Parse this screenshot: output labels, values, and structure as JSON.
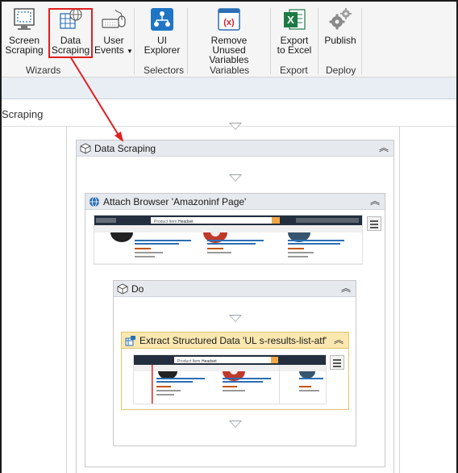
{
  "ribbon": {
    "buttons": [
      {
        "key": "screen_scraping",
        "label": "Screen\nScraping"
      },
      {
        "key": "data_scraping",
        "label": "Data\nScraping"
      },
      {
        "key": "user_events",
        "label": "User\nEvents",
        "dropdown": true
      },
      {
        "key": "ui_explorer",
        "label": "UI\nExplorer"
      },
      {
        "key": "remove_unused_variables",
        "label": "Remove Unused\nVariables"
      },
      {
        "key": "export_to_excel",
        "label": "Export\nto Excel"
      },
      {
        "key": "publish",
        "label": "Publish"
      }
    ],
    "groups": [
      "Wizards",
      "Selectors",
      "Variables",
      "Export",
      "Deploy"
    ]
  },
  "tab": {
    "title": "Scraping"
  },
  "workflow": {
    "data_scraping": {
      "title": "Data Scraping"
    },
    "attach_browser": {
      "title": "Attach Browser 'Amazoninf Page'",
      "search_text": "Product Item",
      "search_value": "Headset"
    },
    "do": {
      "title": "Do"
    },
    "extract": {
      "title": "Extract Structured Data 'UL  s-results-list-atf'",
      "search_text": "Product Item",
      "search_value": "Headset"
    }
  },
  "colors": {
    "highlight": "#e02020",
    "arrow": "#e02020",
    "extract_header": "#fbe8b0",
    "header": "#e6e9ee"
  }
}
